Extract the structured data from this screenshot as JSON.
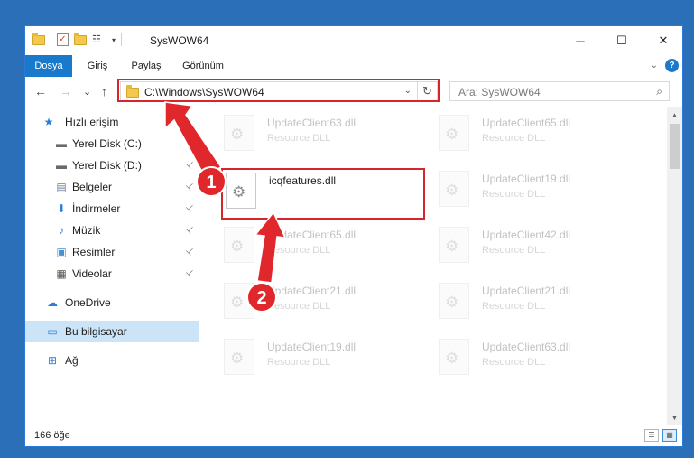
{
  "window": {
    "title": "SysWOW64"
  },
  "controls": {
    "minimize": "─",
    "maximize": "☐",
    "close": "✕"
  },
  "ribbon": {
    "tabs": [
      "Dosya",
      "Giriş",
      "Paylaş",
      "Görünüm"
    ],
    "expand": "⌄",
    "help": "?"
  },
  "nav": {
    "back": "←",
    "forward": "→",
    "recent": "⌄",
    "up": "↑"
  },
  "address": {
    "path": "C:\\Windows\\SysWOW64",
    "drop": "⌄",
    "refresh": "↻"
  },
  "search": {
    "placeholder": "Ara: SysWOW64",
    "icon": "⌕"
  },
  "sidebar": {
    "items": [
      {
        "label": "Hızlı erişim",
        "icon": "star-icon",
        "glyph": "★",
        "color": "#2b7fd9"
      },
      {
        "label": "Yerel Disk (C:)",
        "icon": "drive-icon",
        "glyph": "▬",
        "color": "#6a6a6a"
      },
      {
        "label": "Yerel Disk (D:)",
        "icon": "drive-icon",
        "glyph": "▬",
        "color": "#6a6a6a"
      },
      {
        "label": "Belgeler",
        "icon": "documents-icon",
        "glyph": "▤",
        "color": "#6a7f9a"
      },
      {
        "label": "İndirmeler",
        "icon": "download-icon",
        "glyph": "⬇",
        "color": "#2b7fd9"
      },
      {
        "label": "Müzik",
        "icon": "music-icon",
        "glyph": "♪",
        "color": "#2b7fd9"
      },
      {
        "label": "Resimler",
        "icon": "pictures-icon",
        "glyph": "▣",
        "color": "#4a8fd0"
      },
      {
        "label": "Videolar",
        "icon": "video-icon",
        "glyph": "▦",
        "color": "#555555"
      },
      {
        "label": "OneDrive",
        "icon": "cloud-icon",
        "glyph": "☁",
        "color": "#2b7fd9"
      },
      {
        "label": "Bu bilgisayar",
        "icon": "computer-icon",
        "glyph": "▭",
        "color": "#2b7fd9"
      },
      {
        "label": "Ağ",
        "icon": "network-icon",
        "glyph": "⊞",
        "color": "#2b7fd9"
      }
    ],
    "pin": "📌"
  },
  "files": [
    {
      "name": "UpdateClient63.dll",
      "type": "Resource DLL"
    },
    {
      "name": "UpdateClient65.dll",
      "type": "Resource DLL"
    },
    {
      "name": "icqfeatures.dll",
      "type": ""
    },
    {
      "name": "UpdateClient19.dll",
      "type": "Resource DLL"
    },
    {
      "name": "UpdateClient65.dll",
      "type": "Resource DLL"
    },
    {
      "name": "UpdateClient42.dll",
      "type": "Resource DLL"
    },
    {
      "name": "UpdateClient21.dll",
      "type": "Resource DLL"
    },
    {
      "name": "UpdateClient21.dll",
      "type": "Resource DLL"
    },
    {
      "name": "UpdateClient19.dll",
      "type": "Resource DLL"
    },
    {
      "name": "UpdateClient63.dll",
      "type": "Resource DLL"
    }
  ],
  "status": {
    "count": "166 öğe"
  },
  "annotations": {
    "step1": "1",
    "step2": "2",
    "color": "#d6262b"
  }
}
